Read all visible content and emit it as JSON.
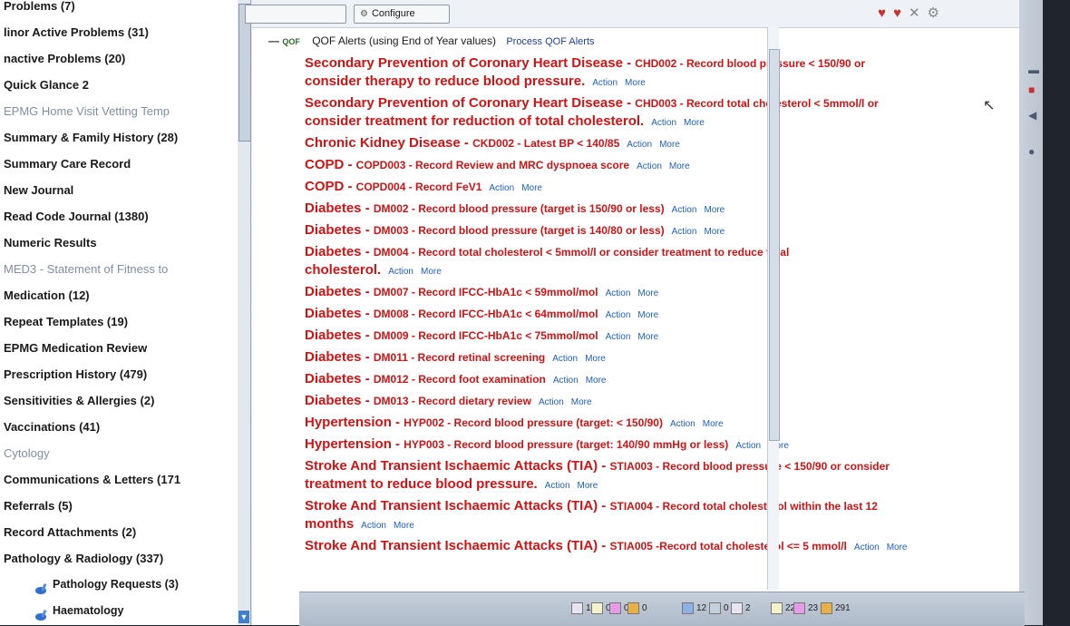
{
  "left_nav": {
    "items": [
      {
        "label": "Problems (7)",
        "style": "normal"
      },
      {
        "label": "linor Active Problems (31)",
        "style": "normal"
      },
      {
        "label": "nactive Problems (20)",
        "style": "normal"
      },
      {
        "label": "Quick Glance 2",
        "style": "normal"
      },
      {
        "label": "EPMG Home Visit Vetting Temp",
        "style": "grey"
      },
      {
        "label": "Summary & Family History (28)",
        "style": "normal"
      },
      {
        "label": "Summary Care Record",
        "style": "normal"
      },
      {
        "label": "New Journal",
        "style": "normal"
      },
      {
        "label": "Read Code Journal (1380)",
        "style": "normal"
      },
      {
        "label": "Numeric Results",
        "style": "normal"
      },
      {
        "label": "MED3 - Statement of Fitness to",
        "style": "grey"
      },
      {
        "label": "Medication (12)",
        "style": "normal"
      },
      {
        "label": "Repeat Templates (19)",
        "style": "normal"
      },
      {
        "label": "EPMG Medication Review",
        "style": "normal"
      },
      {
        "label": "Prescription History (479)",
        "style": "normal"
      },
      {
        "label": "Sensitivities & Allergies (2)",
        "style": "normal"
      },
      {
        "label": "Vaccinations (41)",
        "style": "normal"
      },
      {
        "label": "Cytology",
        "style": "grey"
      },
      {
        "label": "Communications & Letters (171",
        "style": "normal"
      },
      {
        "label": "Referrals (5)",
        "style": "normal"
      },
      {
        "label": "Record Attachments (2)",
        "style": "normal"
      },
      {
        "label": "Pathology & Radiology (337)",
        "style": "normal"
      },
      {
        "label": "Pathology Requests (3)",
        "style": "sub"
      },
      {
        "label": "Haematology",
        "style": "sub"
      }
    ]
  },
  "toolbar": {
    "configure_label": "Configure"
  },
  "qof": {
    "icon_text": "QOF",
    "title": "QOF Alerts (using End of Year values)",
    "process_link": "Process QOF Alerts"
  },
  "alerts": [
    {
      "condition": "Secondary Prevention of Coronary Heart Disease - ",
      "detail": "CHD002 - Record blood pressure < 150/90 or ",
      "tail": "consider therapy to reduce blood pressure."
    },
    {
      "condition": "Secondary Prevention of Coronary Heart Disease - ",
      "detail": "CHD003 - Record total cholesterol < 5mmol/l or ",
      "tail": "consider treatment for reduction of total cholesterol."
    },
    {
      "condition": "Chronic Kidney Disease - ",
      "detail": "CKD002 - Latest BP < 140/85",
      "tail": ""
    },
    {
      "condition": "COPD - ",
      "detail": "COPD003 - Record Review and MRC dyspnoea score",
      "tail": ""
    },
    {
      "condition": "COPD - ",
      "detail": "COPD004 - Record FeV1",
      "tail": ""
    },
    {
      "condition": "Diabetes - ",
      "detail": "DM002 - Record blood pressure (target is 150/90 or less)",
      "tail": ""
    },
    {
      "condition": "Diabetes - ",
      "detail": "DM003 - Record blood pressure (target is 140/80 or less)",
      "tail": ""
    },
    {
      "condition": "Diabetes - ",
      "detail": "DM004 -  Record total cholesterol < 5mmol/l or consider treatment to reduce total ",
      "tail": "cholesterol."
    },
    {
      "condition": "Diabetes - ",
      "detail": "DM007 - Record IFCC-HbA1c < 59mmol/mol",
      "tail": ""
    },
    {
      "condition": "Diabetes - ",
      "detail": "DM008 - Record IFCC-HbA1c < 64mmol/mol",
      "tail": ""
    },
    {
      "condition": "Diabetes - ",
      "detail": "DM009 - Record IFCC-HbA1c < 75mmol/mol",
      "tail": ""
    },
    {
      "condition": "Diabetes - ",
      "detail": "DM011 - Record retinal screening",
      "tail": ""
    },
    {
      "condition": "Diabetes - ",
      "detail": "DM012 - Record foot examination",
      "tail": ""
    },
    {
      "condition": "Diabetes - ",
      "detail": "DM013 - Record dietary review",
      "tail": ""
    },
    {
      "condition": "Hypertension - ",
      "detail": "HYP002 - Record blood pressure (target: < 150/90)",
      "tail": ""
    },
    {
      "condition": "Hypertension - ",
      "detail": "HYP003 - Record blood pressure (target: 140/90 mmHg or less)",
      "tail": ""
    },
    {
      "condition": "Stroke And Transient Ischaemic Attacks (TIA) - ",
      "detail": "STIA003 - Record blood pressure < 150/90 or consider ",
      "tail": "treatment to reduce blood pressure."
    },
    {
      "condition": "Stroke And Transient Ischaemic Attacks (TIA) - ",
      "detail": "STIA004 - Record total cholesterol within the last 12 ",
      "tail": "months"
    },
    {
      "condition": "Stroke And Transient Ischaemic Attacks (TIA) - ",
      "detail": "STIA005 -Record total cholesterol <= 5 mmol/l",
      "tail": ""
    }
  ],
  "links": {
    "action": "Action",
    "more": "More"
  },
  "taskbar": {
    "items": [
      "1",
      "0",
      "0",
      "0",
      "12",
      "0",
      "2",
      "22",
      "23",
      "291"
    ],
    "colors": [
      "#e7e3f0",
      "#f4f2c8",
      "#e59be5",
      "#e8b045",
      "#8fb0e6",
      "#c5cfda"
    ]
  },
  "colors": {
    "alert_red": "#cc1515",
    "link_blue": "#1f5fbf"
  }
}
